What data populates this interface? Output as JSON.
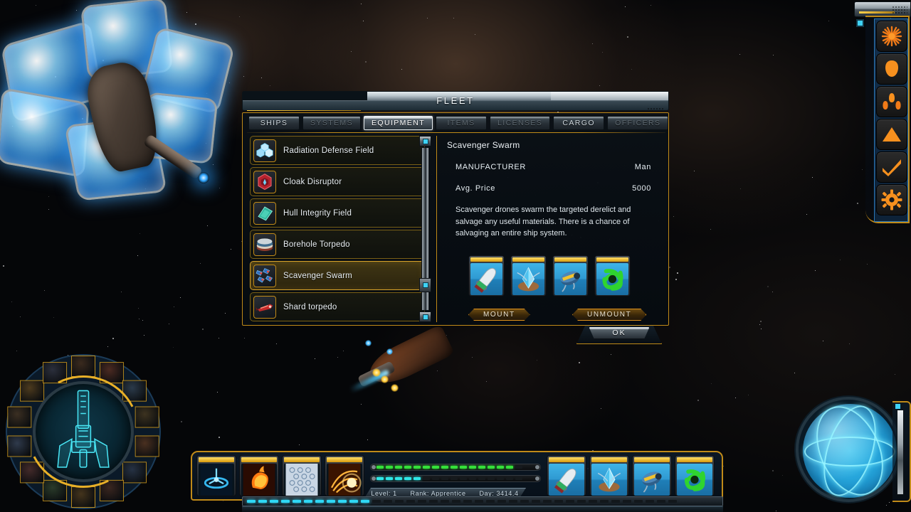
{
  "window": {
    "title": "FLEET",
    "ok_label": "OK"
  },
  "tabs": [
    {
      "label": "SHIPS",
      "state": "normal"
    },
    {
      "label": "SYSTEMS",
      "state": "dim"
    },
    {
      "label": "EQUIPMENT",
      "state": "active"
    },
    {
      "label": "ITEMS",
      "state": "dim"
    },
    {
      "label": "LICENSES",
      "state": "dim"
    },
    {
      "label": "CARGO",
      "state": "normal"
    },
    {
      "label": "OFFICERS",
      "state": "dim"
    }
  ],
  "equipment_list": [
    {
      "label": "Radiation Defense Field",
      "icon": "hex-crystal-icon",
      "selected": false
    },
    {
      "label": "Cloak Disruptor",
      "icon": "red-hexagon-icon",
      "selected": false
    },
    {
      "label": "Hull Integrity Field",
      "icon": "teal-plate-icon",
      "selected": false
    },
    {
      "label": "Borehole Torpedo",
      "icon": "layered-disc-icon",
      "selected": false
    },
    {
      "label": "Scavenger Swarm",
      "icon": "drone-swarm-icon",
      "selected": true
    },
    {
      "label": "Shard torpedo",
      "icon": "red-torpedo-icon",
      "selected": false
    }
  ],
  "detail": {
    "name": "Scavenger Swarm",
    "manufacturer_label": "MANUFACTURER",
    "manufacturer_value": "Man",
    "price_label": "Avg. Price",
    "price_value": "5000",
    "description": "Scavenger drones swarm the targeted derelict and salvage any useful materials. There is a chance of salvaging an entire ship system.",
    "mount_label": "MOUNT",
    "unmount_label": "UNMOUNT",
    "slots": [
      {
        "name": "missile-slot",
        "icon": "white-missile-icon"
      },
      {
        "name": "crystal-slot",
        "icon": "blue-crystal-pod-icon"
      },
      {
        "name": "drone-slot",
        "icon": "yellow-drone-icon"
      },
      {
        "name": "swarm-slot",
        "icon": "green-swarm-icon"
      }
    ]
  },
  "right_rail": [
    {
      "name": "starburst-icon",
      "label": "Starburst"
    },
    {
      "name": "crew-head-icon",
      "label": "Crew"
    },
    {
      "name": "fleet-ships-icon",
      "label": "Fleet"
    },
    {
      "name": "triangle-up-icon",
      "label": "Upgrade"
    },
    {
      "name": "checkmark-icon",
      "label": "Confirm"
    },
    {
      "name": "gear-icon",
      "label": "Settings"
    }
  ],
  "hud": {
    "left_icons": [
      {
        "name": "shield-ring-icon"
      },
      {
        "name": "fire-fist-icon"
      },
      {
        "name": "hex-grid-icon"
      },
      {
        "name": "warp-vortex-icon"
      }
    ],
    "right_icons": [
      {
        "name": "white-missile-icon"
      },
      {
        "name": "blue-crystal-pod-icon"
      },
      {
        "name": "yellow-drone-icon"
      },
      {
        "name": "green-swarm-icon"
      }
    ],
    "bars": [
      {
        "name": "hull-bar",
        "color": "#35e03a",
        "segments": 16,
        "filled": 15
      },
      {
        "name": "shield-bar",
        "color": "#2fe8e8",
        "segments": 16,
        "filled": 5
      }
    ],
    "bottom_bar": {
      "name": "warp-bar",
      "color": "#2fd8f5",
      "segments": 38,
      "filled": 11
    },
    "status": {
      "level": "Level: 1",
      "rank": "Rank: Apprentice",
      "day": "Day: 3414.4"
    }
  },
  "colors": {
    "accent_gold": "#c08a18",
    "accent_cyan": "#3fd2f5",
    "panel_bg": "#0a1016",
    "text_light": "#e8eef2"
  }
}
